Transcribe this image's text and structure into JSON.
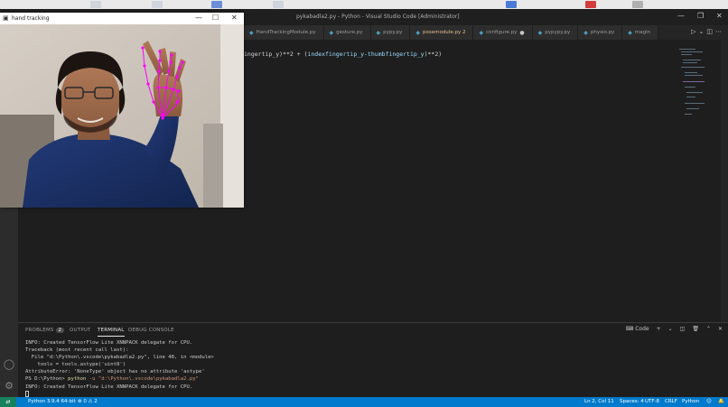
{
  "window": {
    "title": "pykabadla2.py - Python - Visual Studio Code [Administrator]",
    "controls": {
      "minimize": "—",
      "maximize": "❐",
      "close": "✕"
    }
  },
  "tabs": [
    {
      "label": "HandTrackingModule.py",
      "modified": false,
      "dirty": false
    },
    {
      "label": "gesture.py",
      "modified": false,
      "dirty": false
    },
    {
      "label": "pypy.py",
      "modified": false,
      "dirty": false
    },
    {
      "label": "posemodule.py 2",
      "modified": true,
      "dirty": false
    },
    {
      "label": "configure.py",
      "modified": false,
      "dirty": true
    },
    {
      "label": "pypypy.py",
      "modified": false,
      "dirty": false
    },
    {
      "label": "physio.py",
      "modified": false,
      "dirty": false
    },
    {
      "label": "magin",
      "modified": false,
      "dirty": false
    }
  ],
  "editor": {
    "code_prefix": "ingertip_y)**2 + (",
    "code_var": "indexfingertip_y-thumbfingertip_y",
    "code_suffix": ")**2)"
  },
  "camera_window": {
    "title": "hand tracking",
    "controls": {
      "minimize": "—",
      "maximize": "☐",
      "close": "✕"
    }
  },
  "panel": {
    "tabs": {
      "problems": "PROBLEMS",
      "problems_count": "2",
      "output": "OUTPUT",
      "terminal": "TERMINAL",
      "debug": "DEBUG CONSOLE"
    },
    "actions": {
      "shell": "Code",
      "add": "+",
      "chevron": "⌄",
      "split": "◫",
      "trash": "🗑",
      "maximize": "⌃",
      "close": "✕"
    },
    "terminal_lines": [
      "INFO: Created TensorFlow Lite XNNPACK delegate for CPU.",
      "Traceback (most recent call last):",
      "  File \"d:\\Python\\.vscode\\pykabadla2.py\", line 48, in <module>",
      "    tools = tools.astype('uint8')",
      "AttributeError: 'NoneType' object has no attribute 'astype'"
    ],
    "prompt": "PS D:\\Python> ",
    "prompt_cmd": "python",
    "prompt_arg": " -u \"d:\\Python\\.vscode\\pykabadla2.py\"",
    "last_line": "INFO: Created TensorFlow Lite XNNPACK delegate for CPU."
  },
  "statusbar": {
    "interpreter": "Python 3.9.4 64-bit",
    "problems": "⊗ 0 ⚠ 2",
    "position": "Ln 2, Col 11",
    "spaces": "Spaces: 4",
    "encoding": "UTF-8",
    "eol": "CRLF",
    "language": "Python"
  },
  "colors": {
    "accent": "#007acc",
    "background": "#1e1e1e",
    "landmark": "#ff00ff"
  }
}
